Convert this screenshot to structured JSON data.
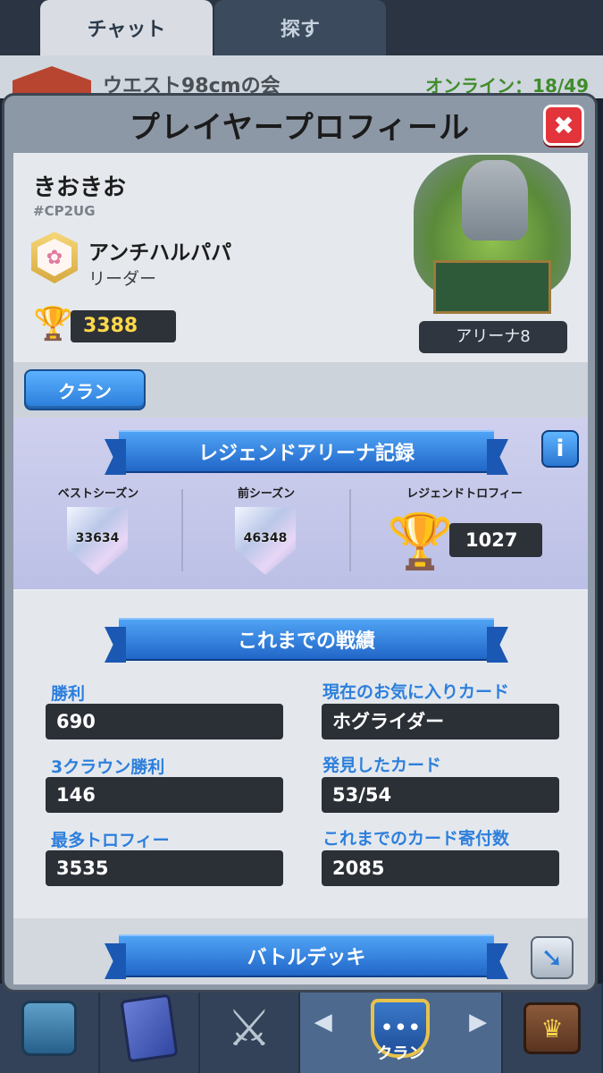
{
  "background": {
    "tabs": [
      "チャット",
      "探す"
    ],
    "clan_name": "ウエスト98cmの会",
    "online": "オンライン：18/49"
  },
  "modal": {
    "title": "プレイヤープロフィール",
    "close_icon": "✖"
  },
  "profile": {
    "name": "きおきお",
    "tag": "#CP2UG",
    "clan": "アンチハルパパ",
    "role": "リーダー",
    "trophies": "3388",
    "arena_label": "アリーナ8"
  },
  "clan_button": "クラン",
  "legend": {
    "title": "レジェンドアリーナ記録",
    "info_icon": "i",
    "best_season_label": "ベストシーズン",
    "best_season_value": "33634",
    "prev_season_label": "前シーズン",
    "prev_season_value": "46348",
    "legend_trophy_label": "レジェンドトロフィー",
    "legend_trophy_value": "1027"
  },
  "stats": {
    "title": "これまでの戦績",
    "items": [
      {
        "label": "勝利",
        "value": "690"
      },
      {
        "label": "現在のお気に入りカード",
        "value": "ホグライダー"
      },
      {
        "label": "3クラウン勝利",
        "value": "146"
      },
      {
        "label": "発見したカード",
        "value": "53/54"
      },
      {
        "label": "最多トロフィー",
        "value": "3535"
      },
      {
        "label": "これまでのカード寄付数",
        "value": "2085"
      }
    ]
  },
  "deck": {
    "title": "バトルデッキ"
  },
  "bottom_nav": {
    "clan_label": "クラン"
  },
  "colors": {
    "accent_blue": "#2d7fdc",
    "trophy_gold": "#ffd84a",
    "close_red": "#e2343a"
  }
}
